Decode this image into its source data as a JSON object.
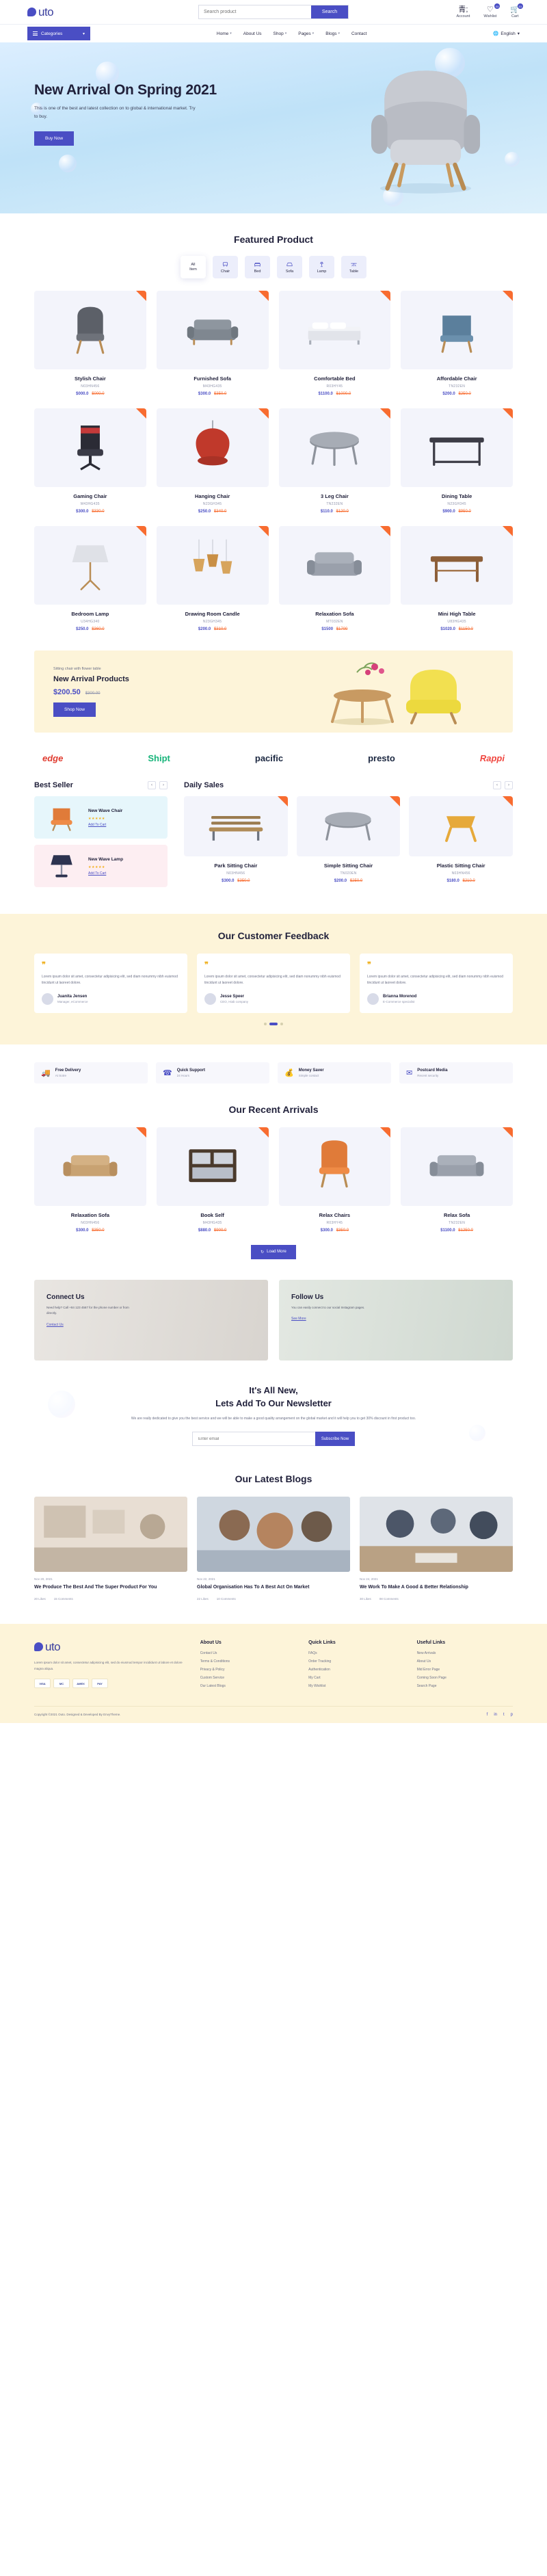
{
  "brand": {
    "name": "uto",
    "accent": "#4a4ec4",
    "orange": "#f86c30"
  },
  "header": {
    "search": {
      "placeholder": "Search product",
      "value": "",
      "button": "Search"
    },
    "icons": [
      {
        "name": "account",
        "label": "Account",
        "badge": ""
      },
      {
        "name": "wishlist",
        "label": "Wishlist",
        "badge": "01"
      },
      {
        "name": "cart",
        "label": "Cart",
        "badge": "01"
      }
    ]
  },
  "nav": {
    "categories_label": "Categories",
    "links": [
      {
        "label": "Home",
        "caret": true
      },
      {
        "label": "About Us",
        "caret": false
      },
      {
        "label": "Shop",
        "caret": true
      },
      {
        "label": "Pages",
        "caret": true
      },
      {
        "label": "Blogs",
        "caret": true
      },
      {
        "label": "Contact",
        "caret": false
      }
    ],
    "language": "English"
  },
  "hero": {
    "title": "New Arrival On Spring 2021",
    "subtitle": "This is one of the best and latest collection on to global & international market. Try to buy.",
    "cta": "Buy Now"
  },
  "featured": {
    "title": "Featured Product",
    "filters": [
      {
        "label_line1": "All",
        "label_line2": "Item",
        "icon": "all-icon",
        "active": true
      },
      {
        "label_line1": "Chair",
        "label_line2": "",
        "icon": "chair-icon",
        "active": false
      },
      {
        "label_line1": "Bed",
        "label_line2": "",
        "icon": "bed-icon",
        "active": false
      },
      {
        "label_line1": "Sofa",
        "label_line2": "",
        "icon": "sofa-icon",
        "active": false
      },
      {
        "label_line1": "Lamp",
        "label_line2": "",
        "icon": "lamp-icon",
        "active": false
      },
      {
        "label_line1": "Table",
        "label_line2": "",
        "icon": "table-icon",
        "active": false
      }
    ],
    "products": [
      {
        "name": "Stylish Chair",
        "code": "N03HN456",
        "price": "$000.0",
        "old": "$000.0"
      },
      {
        "name": "Furnished Sofa",
        "code": "M43HG435",
        "price": "$300.0",
        "old": "$350.0"
      },
      {
        "name": "Comfortable Bed",
        "code": "R03HY45",
        "price": "$1100.0",
        "old": "$1000.0"
      },
      {
        "name": "Affordable Chair",
        "code": "TN232EN",
        "price": "$200.0",
        "old": "$250.0"
      },
      {
        "name": "Gaming Chair",
        "code": "M43HG435",
        "price": "$300.0",
        "old": "$330.0"
      },
      {
        "name": "Hanging Chair",
        "code": "N23GH345",
        "price": "$250.0",
        "old": "$340.0"
      },
      {
        "name": "3 Leg Chair",
        "code": "TN232EN",
        "price": "$110.0",
        "old": "$120.0"
      },
      {
        "name": "Dining Table",
        "code": "N23GH345",
        "price": "$900.0",
        "old": "$950.0"
      },
      {
        "name": "Bedroom Lamp",
        "code": "U34HG340",
        "price": "$250.0",
        "old": "$360.0"
      },
      {
        "name": "Drawing Room Candle",
        "code": "N23GH345",
        "price": "$200.0",
        "old": "$310.0"
      },
      {
        "name": "Relaxation Sofa",
        "code": "MT032EN",
        "price": "$1500",
        "old": "$1700"
      },
      {
        "name": "Mini High Table",
        "code": "U83HG435",
        "price": "$1020.0",
        "old": "$1150.0"
      }
    ]
  },
  "promo": {
    "kicker": "Sitting chair with flower table",
    "title": "New Arrival Products",
    "price": "$200.50",
    "old_price": "$300.00",
    "cta": "Shop Now"
  },
  "brands": [
    {
      "name": "edge",
      "class": "b-edge"
    },
    {
      "name": "Shipt",
      "class": "b-shipt"
    },
    {
      "name": "pacific",
      "class": "b-pacific"
    },
    {
      "name": "presto",
      "class": "b-presto"
    },
    {
      "name": "Rappi",
      "class": "b-rappi"
    }
  ],
  "best_seller": {
    "title": "Best Seller",
    "items": [
      {
        "name": "New Wave Chair",
        "rating": "★★★★★",
        "link": "Add To Cart"
      },
      {
        "name": "New Wave Lamp",
        "rating": "★★★★★",
        "link": "Add To Cart"
      }
    ]
  },
  "daily_sales": {
    "title": "Daily Sales",
    "products": [
      {
        "name": "Park Sitting Chair",
        "code": "N03HN456",
        "price": "$300.0",
        "old": "$350.0"
      },
      {
        "name": "Simple Sitting Chair",
        "code": "TN020EN",
        "price": "$200.0",
        "old": "$250.0"
      },
      {
        "name": "Plastic Sitting Chair",
        "code": "N03HN456",
        "price": "$180.0",
        "old": "$210.0"
      }
    ]
  },
  "feedback": {
    "title": "Our Customer Feedback",
    "cards": [
      {
        "text": "Lorem ipsum dolor sit amet, consectetur adipisicing elit, sed diam nonummy nibh euismod tincidunt ut laoreet dolore.",
        "name": "Juanita Jensen",
        "role": "Manager, eCommerce"
      },
      {
        "text": "Lorem ipsum dolor sit amet, consectetur adipisicing elit, sed diam nonummy nibh euismod tincidunt ut laoreet dolore.",
        "name": "Jesse Speer",
        "role": "CEO, Hiab company"
      },
      {
        "text": "Lorem ipsum dolor sit amet, consectetur adipisicing elit, sed diam nonummy nibh euismod tincidunt ut laoreet dolore.",
        "name": "Brianna Morenod",
        "role": "E-Commerce specialist"
      }
    ]
  },
  "features": [
    {
      "icon": "truck-icon",
      "title": "Free Delivery",
      "sub": "At Sotre"
    },
    {
      "icon": "support-icon",
      "title": "Quick Support",
      "sub": "24 Hours"
    },
    {
      "icon": "money-icon",
      "title": "Money Saver",
      "sub": "Simple contact"
    },
    {
      "icon": "media-icon",
      "title": "Postcard Media",
      "sub": "Recent security"
    }
  ],
  "recent": {
    "title": "Our Recent Arrivals",
    "products": [
      {
        "name": "Relaxation Sofa",
        "code": "N03HN456",
        "price": "$300.0",
        "old": "$350.0"
      },
      {
        "name": "Book Self",
        "code": "M43HG435",
        "price": "$880.0",
        "old": "$900.0"
      },
      {
        "name": "Relax Chairs",
        "code": "R03HY45",
        "price": "$300.0",
        "old": "$350.0"
      },
      {
        "name": "Relax Sofa",
        "code": "TN232EN",
        "price": "$1100.0",
        "old": "$1250.0"
      }
    ],
    "load_more": "Load More"
  },
  "connect": {
    "title": "Connect Us",
    "text": "Need help? Call +84 123 4567 for the phone number or from directly.",
    "link": "Contact Us"
  },
  "follow": {
    "title": "Follow Us",
    "text": "You can easily connect to our social Instagram pages.",
    "link": "See More"
  },
  "newsletter": {
    "title_line1": "It's All New,",
    "title_line2": "Lets Add To Our Newsletter",
    "text": "We are really dedicated to give you the best service and we will be able to make a good quality arrangement on the global market and it will help you to get 30% discount in first product too.",
    "placeholder": "Enter email",
    "cta": "Subscribe Now"
  },
  "blogs": {
    "title": "Our Latest Blogs",
    "posts": [
      {
        "date": "Nov 20, 2021",
        "title": "We Produce The Best And The Super Product For You",
        "likes": "20 Likes",
        "comments": "15 Comments"
      },
      {
        "date": "Nov 22, 2021",
        "title": "Global Organisation Has To A Best Act On Market",
        "likes": "22 Likes",
        "comments": "10 Comments"
      },
      {
        "date": "Nov 24, 2021",
        "title": "We Work To Make A Good & Better Relationship",
        "likes": "30 Likes",
        "comments": "08 Comments"
      }
    ]
  },
  "footer": {
    "about_text": "Lorem ipsum dolor sit amet, consectetur adipisicing elit, sed do eiusmod tempor incididunt ut labore et dolore magna aliqua.",
    "payments": [
      "VISA",
      "MC",
      "AMEX",
      "PAY"
    ],
    "columns": [
      {
        "title": "About Us",
        "links": [
          "Contact Us",
          "Terms & Conditions",
          "Privacy & Policy",
          "Custom Service",
          "Our Latest Blogs"
        ]
      },
      {
        "title": "Quick Links",
        "links": [
          "FAQs",
          "Order Tracking",
          "Authentication",
          "My Cart",
          "My Wishlist"
        ]
      },
      {
        "title": "Useful Links",
        "links": [
          "New Arrivals",
          "About Us",
          "Mid Error Page",
          "Coming Soon Page",
          "Search Page"
        ]
      }
    ],
    "copyright": "Copyright ©2021 Outo. Designed & Developed By EnvyTheme.",
    "socials": [
      "f",
      "in",
      "t",
      "p"
    ]
  }
}
